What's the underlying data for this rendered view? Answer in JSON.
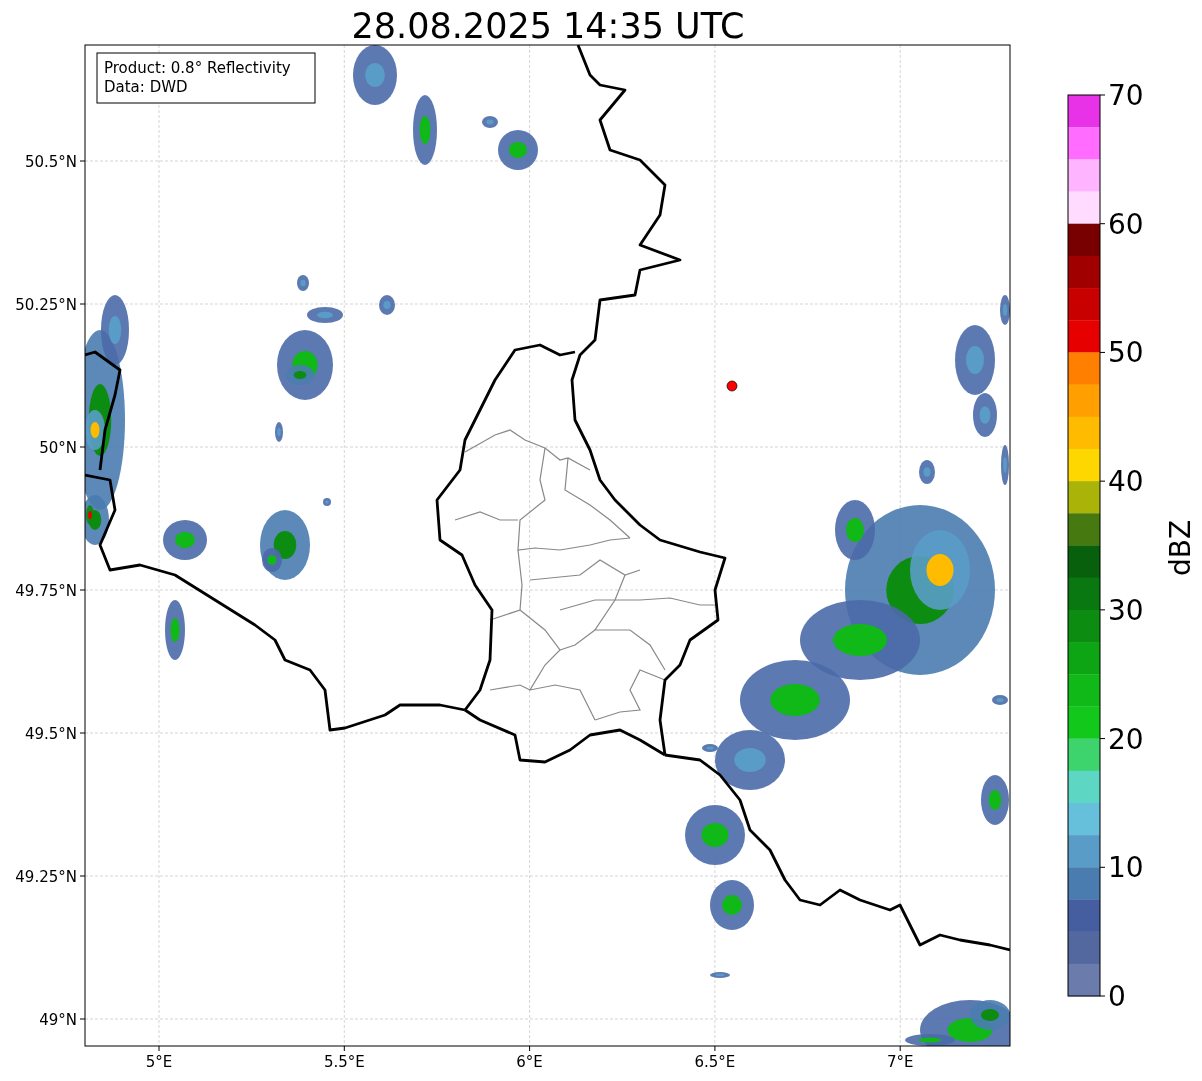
{
  "title": "28.08.2025 14:35 UTC",
  "info_box": [
    "Product: 0.8° Reflectivity",
    "Data: DWD"
  ],
  "map": {
    "lat_ticks": [
      "50.5°N",
      "50.25°N",
      "50°N",
      "49.75°N",
      "49.5°N",
      "49.25°N",
      "49°N"
    ],
    "lon_ticks": [
      "5°E",
      "5.5°E",
      "6°E",
      "6.5°E",
      "7°E"
    ]
  },
  "colorbar": {
    "label": "dBZ",
    "ticks": [
      "70",
      "60",
      "50",
      "40",
      "30",
      "20",
      "10",
      "0"
    ],
    "bins": [
      {
        "color": "#e832e8"
      },
      {
        "color": "#ff6cff"
      },
      {
        "color": "#ffb4ff"
      },
      {
        "color": "#ffdcff"
      },
      {
        "color": "#780000"
      },
      {
        "color": "#a00000"
      },
      {
        "color": "#c80000"
      },
      {
        "color": "#e60000"
      },
      {
        "color": "#ff8000"
      },
      {
        "color": "#ff9f00"
      },
      {
        "color": "#ffbb00"
      },
      {
        "color": "#ffd700"
      },
      {
        "color": "#aab408"
      },
      {
        "color": "#467a10"
      },
      {
        "color": "#08600c"
      },
      {
        "color": "#0a7810"
      },
      {
        "color": "#0c8c10"
      },
      {
        "color": "#0ea514"
      },
      {
        "color": "#10b818"
      },
      {
        "color": "#12c81a"
      },
      {
        "color": "#3dd46e"
      },
      {
        "color": "#5ed6c4"
      },
      {
        "color": "#66c0dc"
      },
      {
        "color": "#5a9cc8"
      },
      {
        "color": "#4a7cb0"
      },
      {
        "color": "#445ea0"
      },
      {
        "color": "#5468a0"
      },
      {
        "color": "#6b7bab"
      }
    ]
  }
}
